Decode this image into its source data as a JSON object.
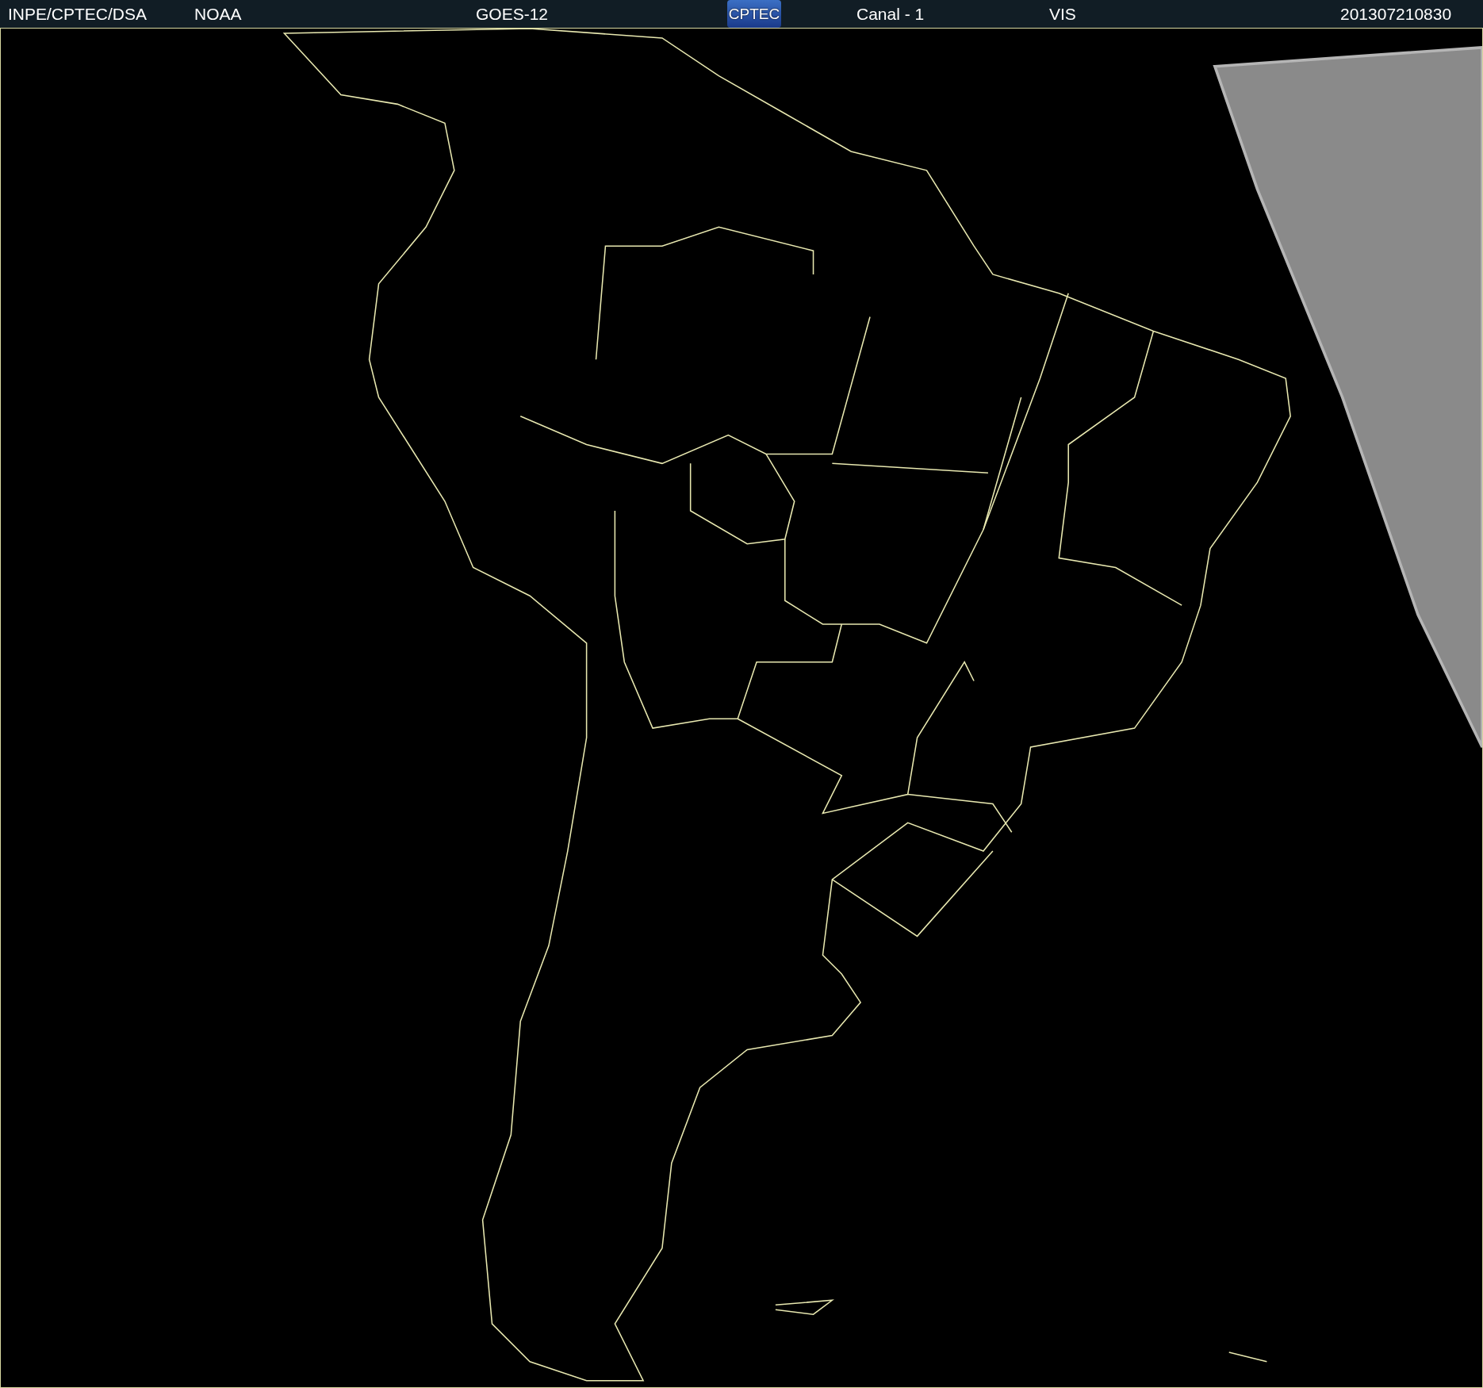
{
  "header": [
    {
      "kind": "text",
      "text": "INPE/CPTEC/DSA"
    },
    {
      "kind": "text",
      "text": "NOAA"
    },
    {
      "kind": "text",
      "text": "GOES-12"
    },
    {
      "kind": "logo",
      "text": "CPTEC"
    },
    {
      "kind": "text",
      "text": "Canal - 1"
    },
    {
      "kind": "text",
      "text": "VIS"
    },
    {
      "kind": "text",
      "text": "201307210830"
    }
  ]
}
